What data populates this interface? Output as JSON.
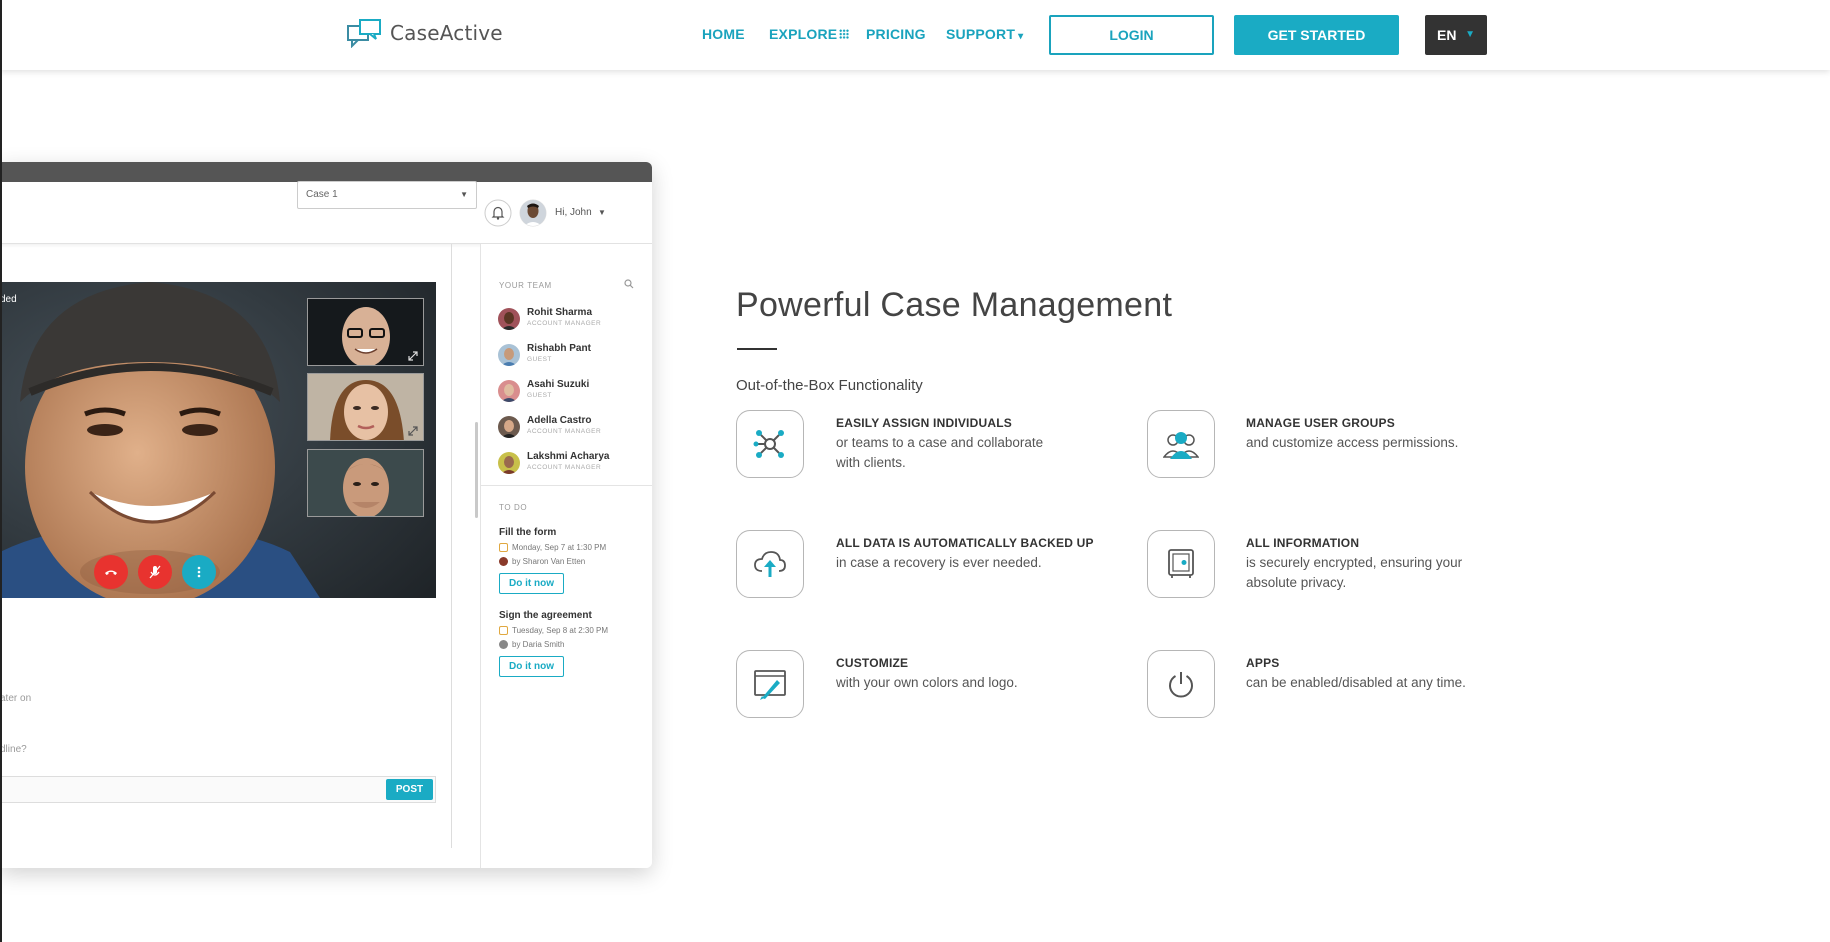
{
  "header": {
    "brand": "CaseActive",
    "nav": {
      "home": "HOME",
      "explore": "EXPLORE",
      "pricing": "PRICING",
      "support": "SUPPORT"
    },
    "support_caret": "▾",
    "login": "LOGIN",
    "get_started": "GET STARTED",
    "language": "EN",
    "language_caret": "▼"
  },
  "app_preview": {
    "case_select": "Case 1",
    "greeting": "Hi, John",
    "video_label": "ded",
    "comment_fragment_1": "ater on",
    "comment_fragment_2": "dline?",
    "post_button": "POST",
    "team_heading": "YOUR TEAM",
    "team": [
      {
        "name": "Rohit Sharma",
        "role": "ACCOUNT MANAGER"
      },
      {
        "name": "Rishabh Pant",
        "role": "GUEST"
      },
      {
        "name": "Asahi Suzuki",
        "role": "GUEST"
      },
      {
        "name": "Adella Castro",
        "role": "ACCOUNT MANAGER"
      },
      {
        "name": "Lakshmi Acharya",
        "role": "ACCOUNT MANAGER"
      }
    ],
    "todo_heading": "TO DO",
    "todos": [
      {
        "title": "Fill the form",
        "date": "Monday, Sep 7 at 1:30 PM",
        "by": "by Sharon Van Etten",
        "action": "Do it now"
      },
      {
        "title": "Sign the agreement",
        "date": "Tuesday, Sep 8 at 2:30 PM",
        "by": "by Daria Smith",
        "action": "Do it now"
      }
    ]
  },
  "hero": {
    "title": "Powerful Case Management",
    "subtitle": "Out-of-the-Box Functionality"
  },
  "features": [
    {
      "icon": "network-icon",
      "title": "EASILY ASSIGN INDIVIDUALS",
      "desc_1": "or teams to a case and collaborate",
      "desc_2": "with clients."
    },
    {
      "icon": "user-group-icon",
      "title": "MANAGE USER GROUPS",
      "desc_1": "and customize access permissions."
    },
    {
      "icon": "cloud-upload-icon",
      "title": "ALL DATA IS AUTOMATICALLY BACKED UP",
      "desc_1": "in case a recovery is ever needed."
    },
    {
      "icon": "safe-icon",
      "title": "ALL INFORMATION",
      "desc_1": "is securely encrypted, ensuring your",
      "desc_2": "absolute privacy."
    },
    {
      "icon": "paint-brush-icon",
      "title": "CUSTOMIZE",
      "desc_1": "with your own colors and logo."
    },
    {
      "icon": "power-icon",
      "title": "APPS",
      "desc_1": "can be enabled/disabled at any time."
    }
  ],
  "colors": {
    "accent": "#1aabc4",
    "dark": "#333333",
    "call_red": "#e8332f"
  }
}
